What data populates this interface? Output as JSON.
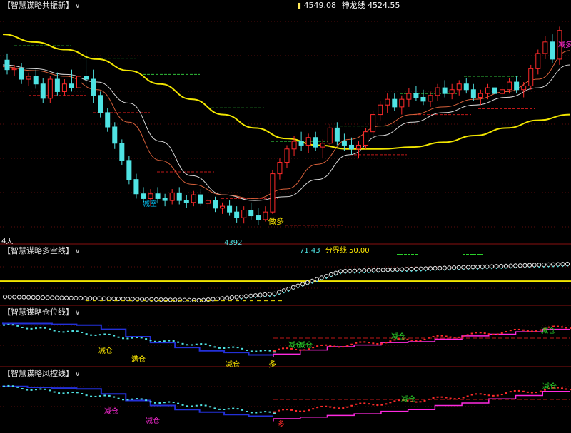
{
  "colors": {
    "background": "#000000",
    "up": "#ff2a2a",
    "down": "#4fe3e3",
    "ma_yellow": "#f2e600",
    "ma_white": "#d8d8d8",
    "ma_orange": "#d7603a",
    "support_green": "#2fbf3a",
    "resist_red": "#c01818",
    "blue_line": "#2330d8",
    "magenta_line": "#ff2ae0",
    "label_cyan": "#00c8ff",
    "label_yellow": "#ffea00",
    "label_green": "#2ad02a",
    "label_magenta": "#ff2ad8"
  },
  "main_panel": {
    "title": "【智慧谋略共振新】",
    "chevron": "∨",
    "price_value": "4549.08",
    "line_name": "神龙线",
    "line_value": "4524.55",
    "axis_corner_label": "4天",
    "low_label": "4392",
    "signals": [
      {
        "text": "减空",
        "color": "#00c8ff"
      },
      {
        "text": "做多",
        "color": "#ffea00"
      },
      {
        "text": "减多",
        "color": "#ff2ad8"
      }
    ]
  },
  "panel2": {
    "title": "【智慧谋略多空线】",
    "chevron": "∨",
    "value": "71.43",
    "divider_name": "分界线",
    "divider_value": "50.00"
  },
  "panel3": {
    "title": "【智慧谋略仓位线】",
    "chevron": "∨",
    "labels": [
      {
        "text": "减仓",
        "color": "#ffea00"
      },
      {
        "text": "满仓",
        "color": "#ffea00"
      },
      {
        "text": "减仓",
        "color": "#ffea00"
      },
      {
        "text": "多",
        "color": "#ffea00"
      },
      {
        "text": "减仓",
        "color": "#2ad02a"
      },
      {
        "text": "减仓",
        "color": "#2ad02a"
      },
      {
        "text": "减仓",
        "color": "#2ad02a"
      },
      {
        "text": "减仓",
        "color": "#2ad02a"
      }
    ]
  },
  "panel4": {
    "title": "【智慧谋略风控线】",
    "chevron": "∨",
    "labels": [
      {
        "text": "减仓",
        "color": "#ff2ad8"
      },
      {
        "text": "减仓",
        "color": "#ff2ad8"
      },
      {
        "text": "多",
        "color": "#ff2a2a"
      },
      {
        "text": "减仓",
        "color": "#2ad02a"
      },
      {
        "text": "减仓",
        "color": "#2ad02a"
      }
    ]
  },
  "chart_data": {
    "type": "candlestick",
    "y_axis_visible": false,
    "grid": "dotted red horizontal lines",
    "candles_ohlc": [
      [
        4565,
        4572,
        4550,
        4555
      ],
      [
        4555,
        4560,
        4548,
        4556
      ],
      [
        4556,
        4562,
        4540,
        4545
      ],
      [
        4545,
        4552,
        4538,
        4548
      ],
      [
        4548,
        4555,
        4535,
        4540
      ],
      [
        4540,
        4546,
        4520,
        4525
      ],
      [
        4525,
        4548,
        4520,
        4545
      ],
      [
        4545,
        4552,
        4528,
        4532
      ],
      [
        4532,
        4545,
        4528,
        4540
      ],
      [
        4540,
        4555,
        4532,
        4536
      ],
      [
        4536,
        4552,
        4530,
        4548
      ],
      [
        4548,
        4575,
        4540,
        4545
      ],
      [
        4545,
        4555,
        4520,
        4528
      ],
      [
        4528,
        4532,
        4505,
        4510
      ],
      [
        4510,
        4515,
        4490,
        4495
      ],
      [
        4495,
        4500,
        4472,
        4478
      ],
      [
        4478,
        4482,
        4455,
        4460
      ],
      [
        4460,
        4465,
        4435,
        4440
      ],
      [
        4440,
        4446,
        4420,
        4425
      ],
      [
        4425,
        4432,
        4415,
        4420
      ],
      [
        4420,
        4430,
        4412,
        4425
      ],
      [
        4425,
        4432,
        4415,
        4420
      ],
      [
        4420,
        4425,
        4412,
        4418
      ],
      [
        4418,
        4430,
        4414,
        4426
      ],
      [
        4426,
        4432,
        4414,
        4418
      ],
      [
        4418,
        4424,
        4410,
        4416
      ],
      [
        4416,
        4428,
        4412,
        4424
      ],
      [
        4424,
        4430,
        4412,
        4415
      ],
      [
        4415,
        4420,
        4410,
        4418
      ],
      [
        4418,
        4422,
        4406,
        4410
      ],
      [
        4410,
        4416,
        4404,
        4412
      ],
      [
        4412,
        4418,
        4402,
        4406
      ],
      [
        4406,
        4412,
        4395,
        4400
      ],
      [
        4400,
        4412,
        4394,
        4408
      ],
      [
        4408,
        4416,
        4398,
        4402
      ],
      [
        4402,
        4410,
        4392,
        4398
      ],
      [
        4398,
        4412,
        4396,
        4406
      ],
      [
        4406,
        4450,
        4404,
        4446
      ],
      [
        4446,
        4462,
        4440,
        4458
      ],
      [
        4458,
        4476,
        4452,
        4472
      ],
      [
        4472,
        4486,
        4465,
        4480
      ],
      [
        4480,
        4490,
        4470,
        4476
      ],
      [
        4476,
        4488,
        4468,
        4484
      ],
      [
        4484,
        4490,
        4470,
        4474
      ],
      [
        4474,
        4482,
        4462,
        4478
      ],
      [
        4478,
        4498,
        4474,
        4494
      ],
      [
        4494,
        4500,
        4476,
        4480
      ],
      [
        4480,
        4488,
        4470,
        4476
      ],
      [
        4476,
        4484,
        4466,
        4472
      ],
      [
        4472,
        4480,
        4462,
        4476
      ],
      [
        4476,
        4494,
        4472,
        4490
      ],
      [
        4490,
        4512,
        4486,
        4508
      ],
      [
        4508,
        4522,
        4502,
        4518
      ],
      [
        4518,
        4530,
        4510,
        4524
      ],
      [
        4524,
        4530,
        4512,
        4516
      ],
      [
        4516,
        4528,
        4508,
        4524
      ],
      [
        4524,
        4536,
        4516,
        4530
      ],
      [
        4530,
        4538,
        4522,
        4526
      ],
      [
        4526,
        4534,
        4518,
        4522
      ],
      [
        4522,
        4532,
        4516,
        4528
      ],
      [
        4528,
        4540,
        4522,
        4536
      ],
      [
        4536,
        4544,
        4526,
        4530
      ],
      [
        4530,
        4540,
        4524,
        4534
      ],
      [
        4534,
        4544,
        4528,
        4540
      ],
      [
        4540,
        4546,
        4530,
        4534
      ],
      [
        4534,
        4540,
        4522,
        4526
      ],
      [
        4526,
        4534,
        4518,
        4530
      ],
      [
        4530,
        4540,
        4524,
        4536
      ],
      [
        4536,
        4542,
        4526,
        4530
      ],
      [
        4530,
        4538,
        4524,
        4534
      ],
      [
        4534,
        4546,
        4530,
        4542
      ],
      [
        4542,
        4548,
        4530,
        4534
      ],
      [
        4534,
        4542,
        4526,
        4538
      ],
      [
        4538,
        4560,
        4534,
        4556
      ],
      [
        4556,
        4576,
        4550,
        4572
      ],
      [
        4572,
        4590,
        4566,
        4584
      ],
      [
        4584,
        4592,
        4562,
        4566
      ],
      [
        4566,
        4600,
        4560,
        4596
      ]
    ],
    "ma_yellow": [
      4592,
      4584,
      4576,
      4566,
      4554,
      4540,
      4524,
      4508,
      4494,
      4483,
      4476,
      4472,
      4472,
      4474,
      4479,
      4486,
      4494,
      4502,
      4508
    ],
    "ma_white": [
      4560,
      4556,
      4550,
      4542,
      4520,
      4480,
      4444,
      4424,
      4418,
      4422,
      4440,
      4466,
      4486,
      4500,
      4510,
      4518,
      4526,
      4536,
      4560
    ],
    "ma_orange": [
      4558,
      4554,
      4548,
      4534,
      4500,
      4460,
      4435,
      4424,
      4420,
      4430,
      4456,
      4482,
      4496,
      4508,
      4516,
      4524,
      4532,
      4545,
      4575
    ],
    "green_levels": [
      4580,
      4567,
      4550,
      4515,
      4480,
      4496,
      4530,
      4548
    ],
    "red_levels": [
      4528,
      4510,
      4448,
      4420,
      4392,
      4466,
      4508,
      4514
    ],
    "dots_panel": {
      "value": 71.43,
      "divider": 50.0,
      "min": 26,
      "max": 76
    },
    "position_line": {
      "min": 0,
      "max": 100
    },
    "risk_line": {
      "min": 0,
      "max": 100
    }
  }
}
